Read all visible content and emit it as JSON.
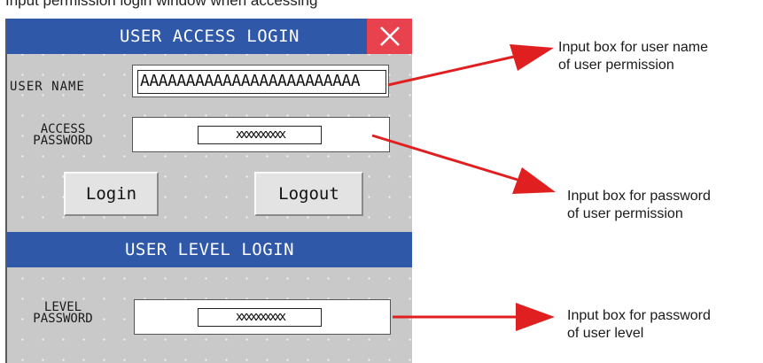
{
  "caption": "Input permission login window when accessing",
  "access_login": {
    "title": "USER ACCESS LOGIN",
    "close_icon": "close-icon",
    "username_label": "USER NAME",
    "username_value": "AAAAAAAAAAAAAAAAAAAAAAAA",
    "password_label_line1": "ACCESS",
    "password_label_line2": "PASSWORD",
    "password_mask": "xxxxxxxxxx",
    "login_button": "Login",
    "logout_button": "Logout"
  },
  "level_login": {
    "title": "USER LEVEL LOGIN",
    "password_label_line1": "LEVEL",
    "password_label_line2": "PASSWORD",
    "password_mask": "xxxxxxxxxx"
  },
  "annotations": {
    "username": {
      "line1": "Input box for user name",
      "line2": "of user permission"
    },
    "access_password": {
      "line1": "Input box for password",
      "line2": "of user permission"
    },
    "level_password": {
      "line1": "Input box for password",
      "line2": "of user level"
    }
  },
  "colors": {
    "title_bar": "#2f58a9",
    "close_button": "#e8424f",
    "panel": "#c9c9c9",
    "arrow": "#e02020"
  }
}
